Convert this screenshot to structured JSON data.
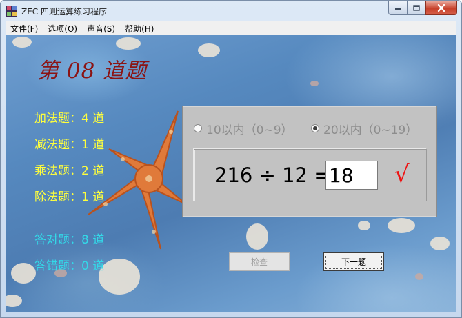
{
  "window": {
    "title": "ZEC 四则运算练习程序"
  },
  "menu": [
    {
      "label": "文件(F)"
    },
    {
      "label": "选项(O)"
    },
    {
      "label": "声音(S)"
    },
    {
      "label": "帮助(H)"
    }
  ],
  "question_title": "第 08 道题",
  "stats": [
    {
      "label": "加法题：",
      "value": "4",
      "unit": " 道"
    },
    {
      "label": "减法题：",
      "value": "1",
      "unit": " 道"
    },
    {
      "label": "乘法题：",
      "value": "2",
      "unit": " 道"
    },
    {
      "label": "除法题：",
      "value": "1",
      "unit": " 道"
    }
  ],
  "results": [
    {
      "label": "答对题：",
      "value": "8",
      "unit": " 道"
    },
    {
      "label": "答错题：",
      "value": "0",
      "unit": " 道"
    }
  ],
  "range_options": [
    {
      "label": "10以内（0~9）",
      "selected": false
    },
    {
      "label": "20以内（0~19）",
      "selected": true
    }
  ],
  "equation": {
    "expression": "216 ÷ 12 =",
    "answer": "18",
    "result_mark": "√"
  },
  "buttons": {
    "check": "检查",
    "next": "下一题"
  },
  "colors": {
    "title_red": "#8b1414",
    "stat_yellow": "#ffff3c",
    "result_cyan": "#33d9e8",
    "correct_mark": "#ee1111"
  }
}
